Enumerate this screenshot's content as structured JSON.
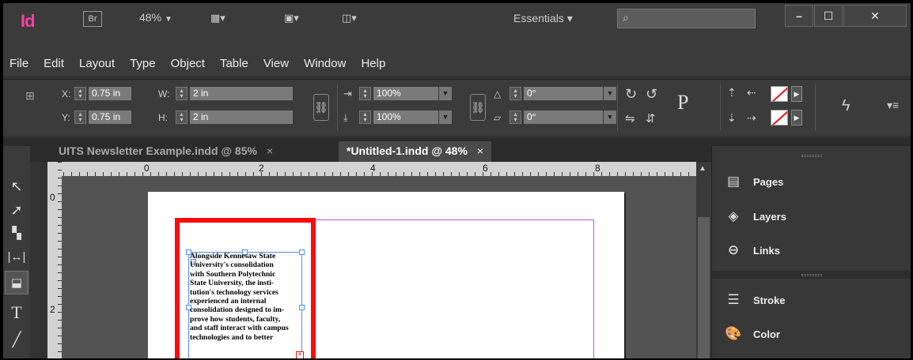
{
  "app": {
    "logo": "Id",
    "bridge": "Br",
    "zoom": "48%",
    "workspace": "Essentials",
    "search_placeholder": ""
  },
  "window_buttons": [
    "–",
    "☐",
    "✕"
  ],
  "menu": [
    "File",
    "Edit",
    "Layout",
    "Type",
    "Object",
    "Table",
    "View",
    "Window",
    "Help"
  ],
  "control": {
    "x_label": "X:",
    "x_value": "0.75 in",
    "y_label": "Y:",
    "y_value": "0.75 in",
    "w_label": "W:",
    "w_value": "2 in",
    "h_label": "H:",
    "h_value": "2 in",
    "scale_x": "100%",
    "scale_y": "100%",
    "rotate": "0°",
    "shear": "0°",
    "paragraph_glyph": "P"
  },
  "tabs": [
    {
      "label": "UITS Newsletter Example.indd @ 85%",
      "close": "×",
      "active": false
    },
    {
      "label": "*Untitled-1.indd @ 48%",
      "close": "×",
      "active": true
    }
  ],
  "ruler_h": [
    "0",
    "2",
    "4",
    "6",
    "8"
  ],
  "ruler_v": [
    "0",
    "2"
  ],
  "story_lines": [
    "Alongside Kennesaw State",
    "University's consolidation",
    "with Southern Polytechnic",
    "State University, the insti-",
    "tution's technology services",
    "experienced an internal",
    "consolidation designed to im-",
    "prove how students, faculty,",
    "and staff interact with campus",
    "technologies and to better"
  ],
  "panels": [
    "Pages",
    "Layers",
    "Links",
    "Stroke",
    "Color"
  ],
  "colors": {
    "accent_logo": "#ff3ea5",
    "selection_frame": "#ff0a0a",
    "margin_guide": "#c64cf0",
    "frame_handles": "#4d8cff"
  }
}
